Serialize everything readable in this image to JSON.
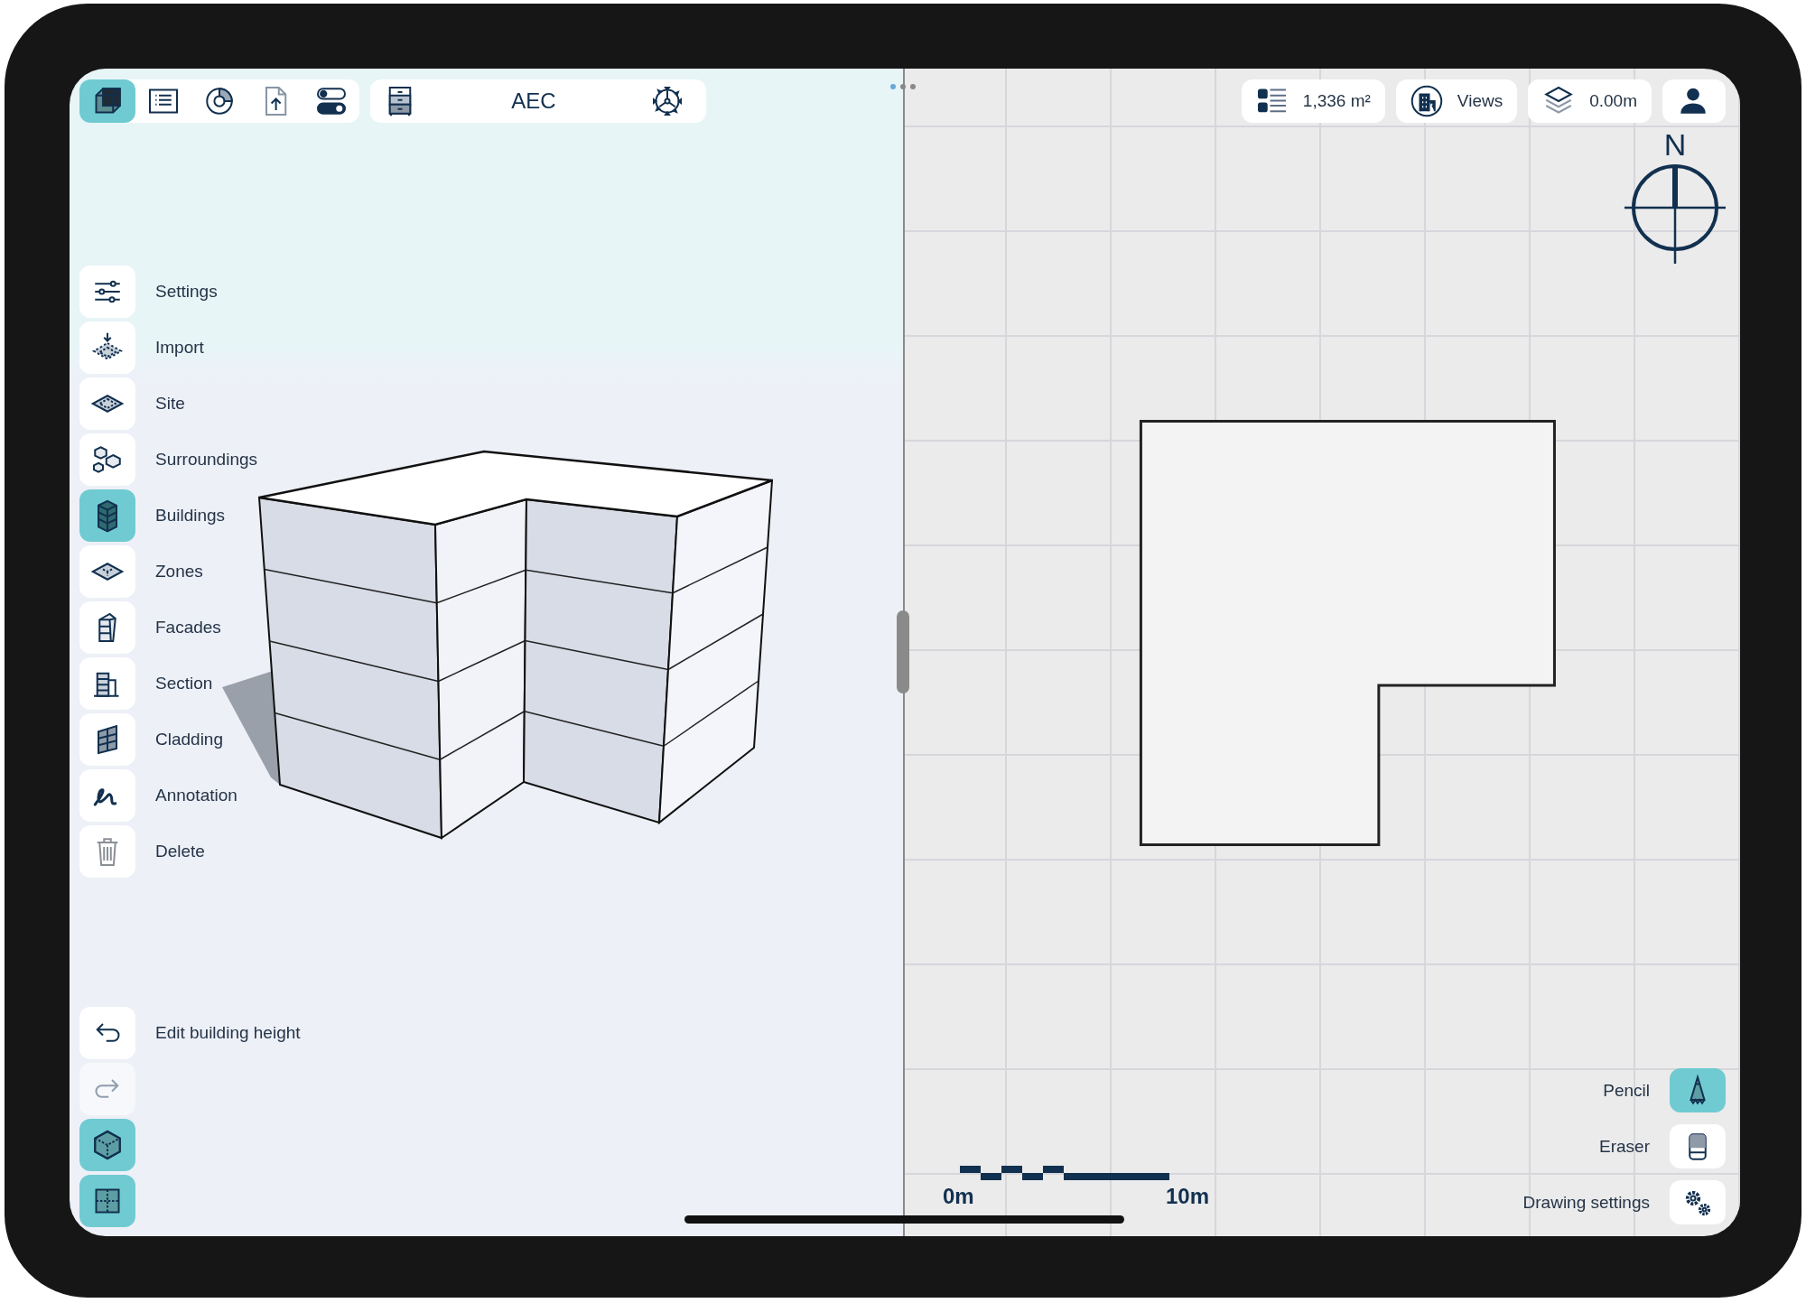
{
  "toolbar": {
    "tools": [
      {
        "kind": "model",
        "selected": true
      },
      {
        "kind": "list",
        "selected": false
      },
      {
        "kind": "chart",
        "selected": false
      },
      {
        "kind": "upload",
        "selected": false
      },
      {
        "kind": "toggles",
        "selected": false
      }
    ],
    "project": {
      "title": "AEC"
    }
  },
  "menu": [
    {
      "kind": "settings",
      "label": "Settings",
      "selected": false
    },
    {
      "kind": "import",
      "label": "Import",
      "selected": false
    },
    {
      "kind": "site",
      "label": "Site",
      "selected": false
    },
    {
      "kind": "surroundings",
      "label": "Surroundings",
      "selected": false
    },
    {
      "kind": "buildings",
      "label": "Buildings",
      "selected": true
    },
    {
      "kind": "zones",
      "label": "Zones",
      "selected": false
    },
    {
      "kind": "facades",
      "label": "Facades",
      "selected": false
    },
    {
      "kind": "section",
      "label": "Section",
      "selected": false
    },
    {
      "kind": "cladding",
      "label": "Cladding",
      "selected": false
    },
    {
      "kind": "annotation",
      "label": "Annotation",
      "selected": false
    },
    {
      "kind": "delete",
      "label": "Delete",
      "selected": false
    }
  ],
  "history": [
    {
      "kind": "undo",
      "label": "Edit building height",
      "disabled": false
    },
    {
      "kind": "redo",
      "disabled": true
    }
  ],
  "view_modes": [
    {
      "kind": "perspective",
      "selected": true
    },
    {
      "kind": "plan",
      "selected": true
    }
  ],
  "plan_toolbar": {
    "area": "1,336 m²",
    "views": "Views",
    "level": "0.00m"
  },
  "compass": {
    "label": "N"
  },
  "scale": {
    "start": "0m",
    "end": "10m"
  },
  "draw_tools": [
    {
      "kind": "pencil",
      "label": "Pencil",
      "selected": true
    },
    {
      "kind": "eraser",
      "label": "Eraser",
      "selected": false
    },
    {
      "kind": "settings",
      "label": "Drawing settings",
      "selected": false
    }
  ]
}
